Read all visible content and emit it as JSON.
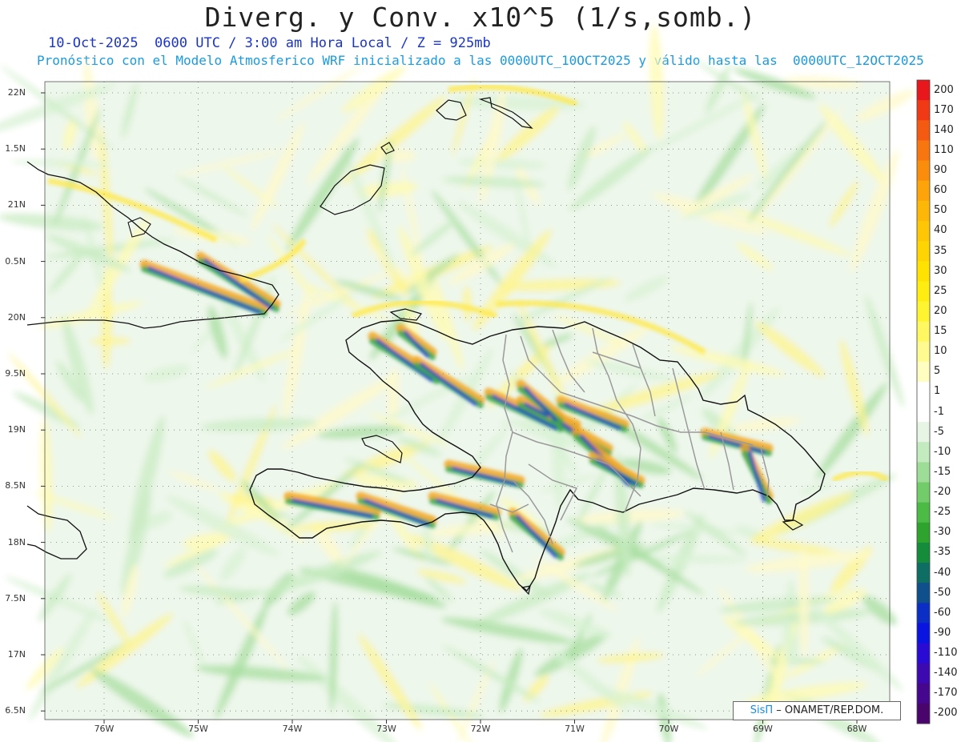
{
  "header": {
    "title": "Diverg. y Conv. x10^5 (1/s,somb.)",
    "line1": "10-Oct-2025  0600 UTC / 3:00 am Hora Local / Z = 925mb",
    "line2": "Pronóstico con el Modelo Atmosferico WRF inicializado a las 0000UTC_10OCT2025 y válido hasta las  0000UTC_12OCT2025"
  },
  "axes": {
    "lat_labels": [
      "22N",
      "1.5N",
      "21N",
      "0.5N",
      "20N",
      "9.5N",
      "19N",
      "8.5N",
      "18N",
      "7.5N",
      "17N",
      "6.5N"
    ],
    "lon_labels": [
      "76W",
      "75W",
      "74W",
      "73W",
      "72W",
      "71W",
      "70W",
      "69W",
      "68W"
    ]
  },
  "colorbar": {
    "labels": [
      "200",
      "170",
      "140",
      "110",
      "90",
      "60",
      "50",
      "40",
      "35",
      "30",
      "25",
      "20",
      "15",
      "10",
      "5",
      "1",
      "-1",
      "-5",
      "-10",
      "-15",
      "-20",
      "-25",
      "-30",
      "-35",
      "-40",
      "-50",
      "-60",
      "-90",
      "-110",
      "-140",
      "-170",
      "-200"
    ],
    "colors": [
      "#e8171b",
      "#f03a16",
      "#f55a12",
      "#f8760f",
      "#fa8e0c",
      "#fca40a",
      "#fdb707",
      "#fec605",
      "#ffd403",
      "#ffe102",
      "#ffec10",
      "#fff430",
      "#fff860",
      "#fffb90",
      "#fffdc0",
      "#ffffff",
      "#ffffff",
      "#e6f5e4",
      "#c4eac0",
      "#9edd97",
      "#72cc6a",
      "#4cbb45",
      "#2ea42f",
      "#148c3a",
      "#0f6e63",
      "#0e4f8c",
      "#0b2fc4",
      "#0a14e0",
      "#2a0bd4",
      "#3d09b0",
      "#45078e",
      "#4a056c"
    ]
  },
  "credit": {
    "sis": "SisΠ",
    "org": " – ONAMET/REP.DOM."
  },
  "colors": {
    "land_border": "#111111",
    "province_border": "#999999",
    "grid": "#777777"
  }
}
